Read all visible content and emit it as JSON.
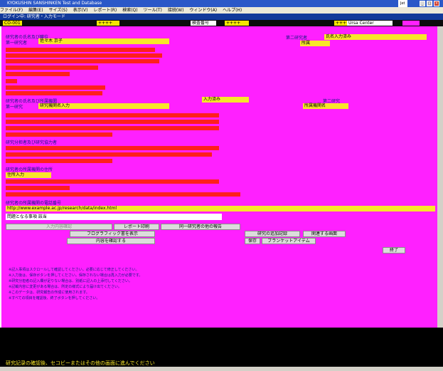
{
  "window": {
    "title": "KYOKUSHIN SANSHINKEN Test and Database",
    "tray_label": "Jet"
  },
  "menu": {
    "items": [
      "ファイル(F)",
      "編集(E)",
      "サイズ(S)",
      "表示(V)",
      "レポート(R)",
      "検索(Q)",
      "ツール(T)",
      "接続(W)",
      "ウィンドウ(A)",
      "ヘルプ(H)"
    ]
  },
  "bluebar": {
    "text": "ログイン中: 研究者・入力モード"
  },
  "toolbar": {
    "badge": "CO-001",
    "field1": "++++",
    "field2": "検査番号",
    "field3": "++++",
    "field4": "++++",
    "search_placeholder": "Ursa Center"
  },
  "form": {
    "q1_label": "研究者の氏名及び職位",
    "q1_sub": "第一研究者",
    "q1_value": "佐々木 京子",
    "q1_right_label": "第二研究者",
    "q1_right_value": "氏名入力済み",
    "q1_right_badge": "所属",
    "q2_label": "研究者の氏名及び所属機関",
    "q2_sub": "第一研究",
    "q2_value": "研究機関名入力",
    "q2_mid_value": "入力済み",
    "q2_right_label": "第二研究",
    "q2_right_value": "所属機関名",
    "q3_label": "研究分担者及び研究協力者",
    "q4_label": "研究者の所属機関の住所",
    "q4_value": "住所入力",
    "q5_label": "研究者の所属機関の電話番号",
    "url_value": "http://www.example.ac.jp/research/data/index.html",
    "problem_label": "問題となる事項 該当"
  },
  "buttons": {
    "b1": "入力内容確認",
    "b2": "レポート印刷",
    "b3": "同一研究者の他の報告",
    "b4": "フログラフィック書を表示",
    "b5": "研究の追加記録",
    "b6": "内容を確認する",
    "b7": "保存",
    "b8": "関連する画面",
    "b9": "前へ",
    "b10": "ブランケットアイテム",
    "b11": "終了"
  },
  "notes": {
    "lines": [
      "※記入事項はスクロールして確認してください。必要に応じて修正してください。",
      "※入力後は、保存ボタンを押してください。保存されない場合は再入力が必要です。",
      "※研究分担者の記入欄が足りない場合は、別紙に記入の上添付してください。",
      "※記載内容に変更がある場合は、所定の様式により届け出てください。",
      "※このデータは、研究報告の作成に使用されます。",
      "※すべての項目を確認後、終了ボタンを押してください。"
    ]
  },
  "status": {
    "text": "研究記录の確認後、セコビーまたはその他の画面に進んでください"
  },
  "colors": {
    "content_bg": "#ff20ff",
    "label_yellow": "#f8e62a",
    "value_red": "#ff1e1e",
    "title_blue": "#2b58c8"
  }
}
